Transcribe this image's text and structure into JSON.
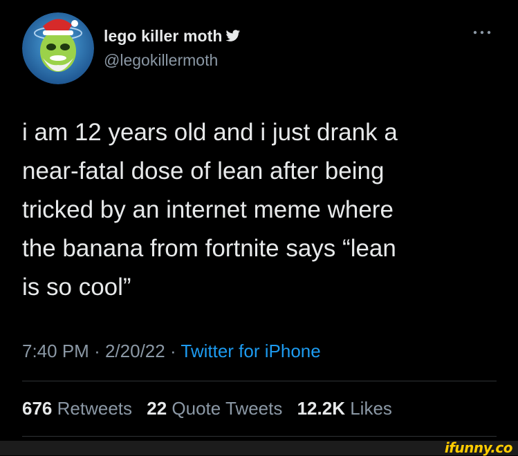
{
  "author": {
    "display_name": "lego killer moth",
    "handle": "@legokillermoth",
    "verified_icon": "twitter-bird-icon",
    "avatar": "alien-santa-avatar"
  },
  "tweet": {
    "text": "i am 12 years old and i just drank a\nnear-fatal dose of lean after being\ntricked by an internet meme where\nthe banana from fortnite says “lean\nis so cool”",
    "time": "7:40 PM",
    "separator": "·",
    "date": "2/20/22",
    "source": "Twitter for iPhone"
  },
  "stats": {
    "retweets_count": "676",
    "retweets_label": "Retweets",
    "quotes_count": "22",
    "quotes_label": "Quote Tweets",
    "likes_count": "12.2K",
    "likes_label": "Likes"
  },
  "menu": {
    "more_icon": "more-horizontal-icon"
  },
  "watermark": {
    "text": "ifunny.co"
  },
  "colors": {
    "background": "#000000",
    "primary_text": "#e7e9ea",
    "secondary_text": "#8b98a5",
    "accent": "#1d9bf0",
    "divider": "#2f3336",
    "watermark": "#ffcc00"
  }
}
